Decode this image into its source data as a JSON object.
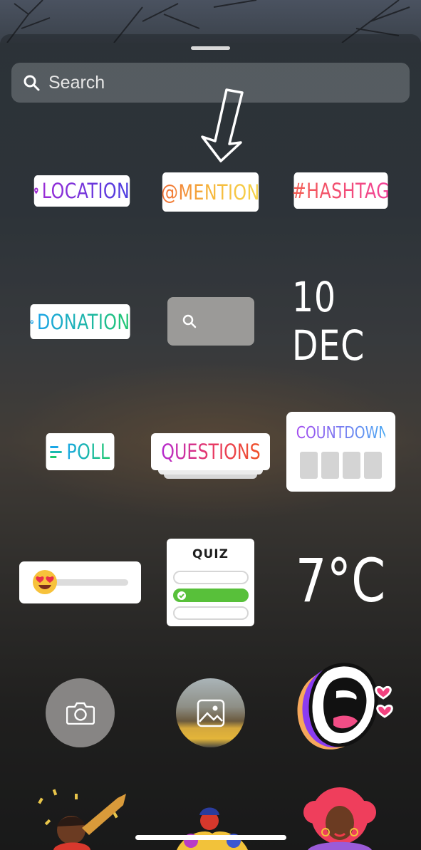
{
  "search": {
    "placeholder": "Search"
  },
  "stickers": {
    "location": "LOCATION",
    "mention": "@MENTION",
    "hashtag": "#HASHTAG",
    "donation": "DONATION",
    "date": "10 DEC",
    "poll": "POLL",
    "questions": "QUESTIONS",
    "countdown": "COUNTDOWN",
    "quiz": "QUIZ",
    "temperature": "7°C"
  },
  "slider": {
    "emoji": "heart-eyes-emoji"
  },
  "quiz": {
    "correct_option_index": 1
  },
  "icons": {
    "search": "search-icon",
    "arrow": "hand-drawn-arrow",
    "camera": "camera-icon",
    "gallery": "image-icon"
  },
  "colors": {
    "location": "#9b2bd6",
    "mention": "#f06b32",
    "hashtag": "#f2429a",
    "donation": "#1aa3e8",
    "poll": "#1ec96d",
    "questions": "#b52bd1",
    "countdown": "#a44cf0",
    "quiz_correct": "#58c03a"
  }
}
